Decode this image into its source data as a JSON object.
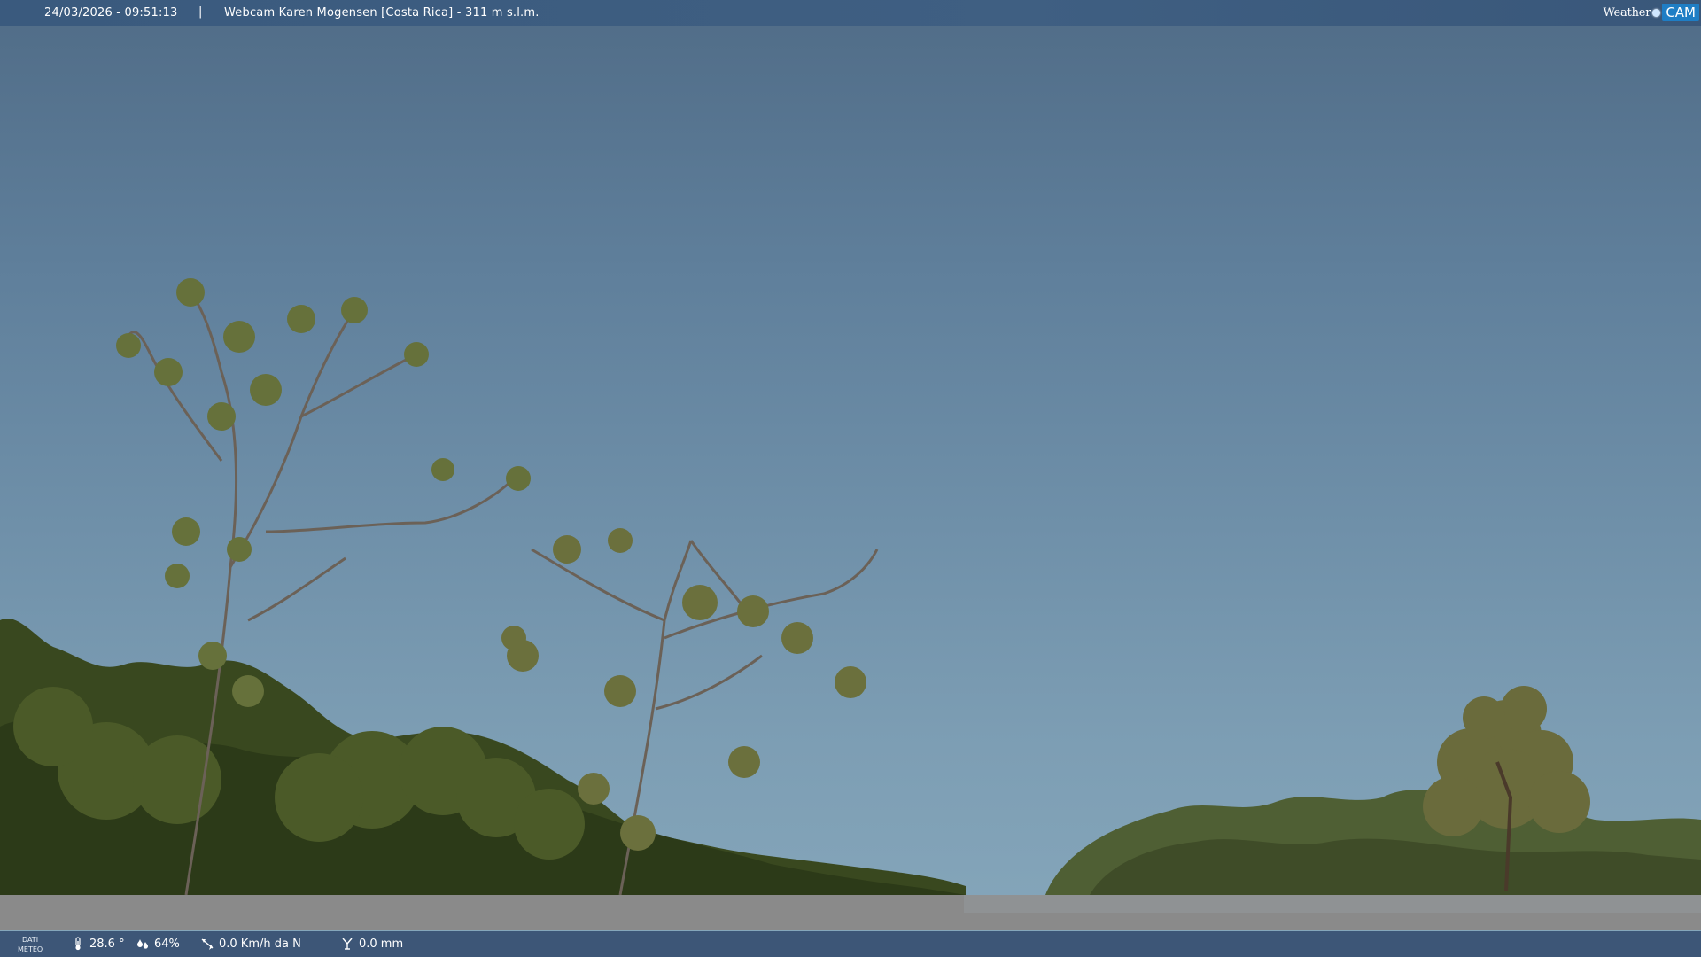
{
  "header": {
    "datetime": "24/03/2026 - 09:51:13",
    "separator": "|",
    "title": "Webcam Karen Mogensen [Costa Rica]  - 311 m s.l.m.",
    "logo_text_weather": "Weather",
    "logo_text_cam": "CAM"
  },
  "footer": {
    "label_line1": "DATI",
    "label_line2": "METEO",
    "temperature": "28.6 °",
    "humidity": "64%",
    "wind": "0.0 Km/h da N",
    "rain": "0.0 mm"
  },
  "icons": {
    "temperature": "thermometer-icon",
    "humidity": "humidity-drops-icon",
    "wind": "wind-vane-icon",
    "rain": "rain-gauge-icon"
  },
  "colors": {
    "bar": "#3d5677",
    "logo_accent": "#1f7ec5",
    "sky_top": "#506c87",
    "sky_bottom": "#86a7bb"
  }
}
